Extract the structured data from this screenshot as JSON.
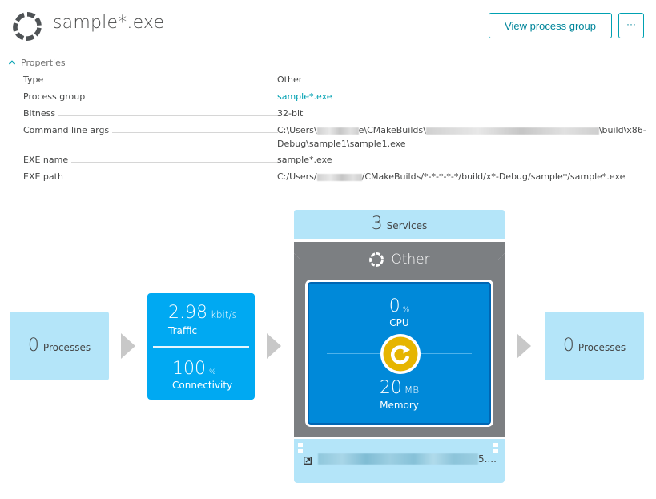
{
  "header": {
    "icon": "process-ring-icon",
    "title": "sample*.exe",
    "view_process_group_label": "View process group",
    "more_label": "···"
  },
  "properties": {
    "section_label": "Properties",
    "toggle_icon": "chevron-up-icon",
    "rows": [
      {
        "key": "Type",
        "value": "Other"
      },
      {
        "key": "Process group",
        "value": "sample*.exe"
      },
      {
        "key": "Bitness",
        "value": "32-bit"
      },
      {
        "key": "Command line args",
        "value_line1_a": "C:\\Users\\",
        "value_line1_b": "e\\CMakeBuilds\\",
        "value_line1_c": "\\build\\x86-",
        "value_line2": "Debug\\sample1\\sample1.exe"
      },
      {
        "key": "EXE name",
        "value": "sample*.exe"
      },
      {
        "key": "EXE path",
        "value_a": "C:/Users/",
        "value_b": "/CMakeBuilds/*-*-*-*-*/build/x*-Debug/sample*/sample*.exe"
      }
    ]
  },
  "flow": {
    "incoming": {
      "count": "0",
      "label": "Processes"
    },
    "traffic": {
      "value": "2.98",
      "unit": "kbit/s",
      "label": "Traffic"
    },
    "connectivity": {
      "value": "100",
      "unit": "%",
      "label": "Connectivity"
    },
    "services": {
      "count": "3",
      "label": "Services"
    },
    "process": {
      "title": "Other",
      "title_icon": "process-ring-icon",
      "cpu": {
        "value": "0",
        "unit": "%",
        "label": "CPU"
      },
      "memory": {
        "value": "20",
        "unit": "MB",
        "label": "Memory"
      },
      "status_icon": "restart-icon",
      "status_color": "#e8b800"
    },
    "host": {
      "link_icon": "external-link-icon",
      "name_suffix": "5...."
    },
    "outgoing": {
      "count": "0",
      "label": "Processes"
    }
  },
  "colors": {
    "accent": "#00a1b2",
    "traffic_blue": "#00a9f2",
    "process_blue": "#0089d9",
    "light_blue": "#b4e5f9",
    "frame_gray": "#7c7f82"
  }
}
